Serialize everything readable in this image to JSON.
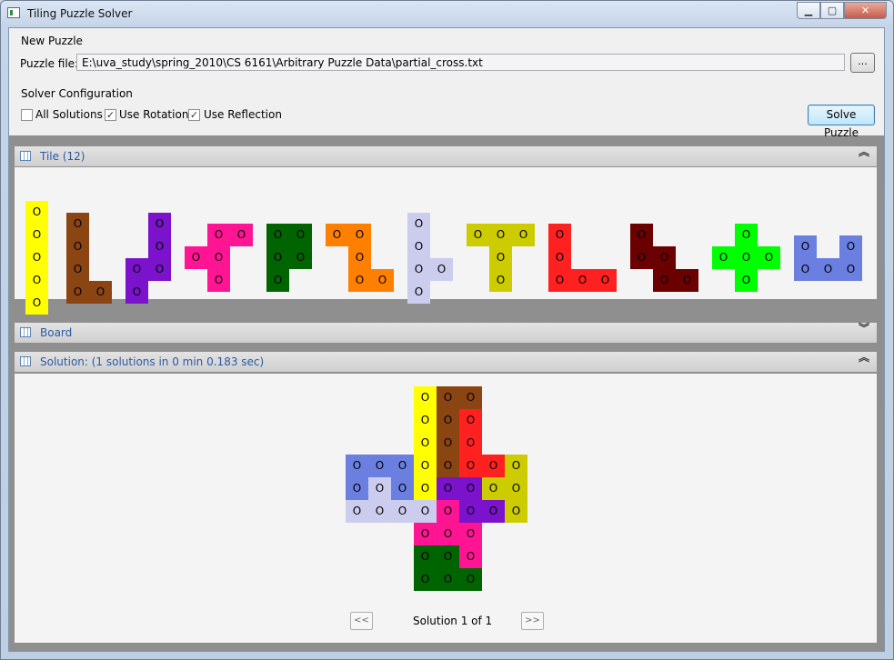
{
  "window": {
    "title": "Tiling Puzzle Solver",
    "minimize": "▁",
    "maximize": "▢",
    "close": "✕"
  },
  "new_puzzle": {
    "group_title": "New Puzzle",
    "file_label": "Puzzle file:",
    "file_value": "E:\\uva_study\\spring_2010\\CS 6161\\Arbitrary Puzzle Data\\partial_cross.txt",
    "browse_label": "..."
  },
  "solver_config": {
    "group_title": "Solver Configuration",
    "options": [
      {
        "label": "All Solutions",
        "checked": false
      },
      {
        "label": "Use Rotation",
        "checked": true
      },
      {
        "label": "Use Reflection",
        "checked": true
      }
    ],
    "solve_label": "Solve Puzzle"
  },
  "panels": {
    "tile": {
      "title": "Tile (12)",
      "state": "expanded"
    },
    "board": {
      "title": "Board",
      "state": "collapsed"
    },
    "solution": {
      "title": "Solution: (1 solutions in 0 min 0.183 sec)",
      "state": "expanded"
    }
  },
  "cell_char": "O",
  "check_char": "✓",
  "chev_expanded": "︽",
  "chev_collapsed": "︾",
  "tiles": [
    {
      "color": "#ffff00",
      "cells": [
        [
          0,
          0
        ],
        [
          0,
          1
        ],
        [
          0,
          2
        ],
        [
          0,
          3
        ],
        [
          0,
          4
        ]
      ]
    },
    {
      "color": "#8b4513",
      "cells": [
        [
          0,
          0
        ],
        [
          0,
          1
        ],
        [
          0,
          2
        ],
        [
          0,
          3
        ],
        [
          1,
          3
        ]
      ]
    },
    {
      "color": "#7b12cc",
      "cells": [
        [
          1,
          0
        ],
        [
          1,
          1
        ],
        [
          0,
          2
        ],
        [
          1,
          2
        ],
        [
          0,
          3
        ]
      ]
    },
    {
      "color": "#ff1493",
      "cells": [
        [
          1,
          0
        ],
        [
          2,
          0
        ],
        [
          0,
          1
        ],
        [
          1,
          1
        ],
        [
          1,
          2
        ]
      ]
    },
    {
      "color": "#006400",
      "cells": [
        [
          0,
          0
        ],
        [
          1,
          0
        ],
        [
          0,
          1
        ],
        [
          1,
          1
        ],
        [
          0,
          2
        ]
      ]
    },
    {
      "color": "#ff8000",
      "cells": [
        [
          0,
          0
        ],
        [
          1,
          0
        ],
        [
          1,
          1
        ],
        [
          1,
          2
        ],
        [
          2,
          2
        ]
      ]
    },
    {
      "color": "#ccccee",
      "cells": [
        [
          0,
          0
        ],
        [
          0,
          1
        ],
        [
          0,
          2
        ],
        [
          1,
          2
        ],
        [
          0,
          3
        ]
      ]
    },
    {
      "color": "#cccc00",
      "cells": [
        [
          0,
          0
        ],
        [
          1,
          0
        ],
        [
          2,
          0
        ],
        [
          1,
          1
        ],
        [
          1,
          2
        ]
      ]
    },
    {
      "color": "#ff2020",
      "cells": [
        [
          0,
          0
        ],
        [
          0,
          1
        ],
        [
          0,
          2
        ],
        [
          1,
          2
        ],
        [
          2,
          2
        ]
      ]
    },
    {
      "color": "#6b0000",
      "cells": [
        [
          0,
          0
        ],
        [
          0,
          1
        ],
        [
          1,
          1
        ],
        [
          1,
          2
        ],
        [
          2,
          2
        ]
      ]
    },
    {
      "color": "#00ff00",
      "cells": [
        [
          1,
          0
        ],
        [
          0,
          1
        ],
        [
          1,
          1
        ],
        [
          2,
          1
        ],
        [
          1,
          2
        ]
      ]
    },
    {
      "color": "#6b7fe0",
      "cells": [
        [
          0,
          0
        ],
        [
          2,
          0
        ],
        [
          0,
          1
        ],
        [
          1,
          1
        ],
        [
          2,
          1
        ]
      ]
    }
  ],
  "solution_grid": [
    "...YBB..",
    "...YBR..",
    "...YBR..",
    "UUUYBRRV",
    "UWUYPPVV",
    "WWWWMPPV",
    "...MMM..",
    "...GGM..",
    "...GGG.."
  ],
  "solution_colors": {
    "Y": "#ffff00",
    "B": "#8b4513",
    "R": "#ff2020",
    "V": "#cccc00",
    "U": "#6b7fe0",
    "W": "#ccccee",
    "P": "#7b12cc",
    "M": "#ff1493",
    "G": "#006400"
  },
  "navigation": {
    "prev": "<<",
    "next": ">>",
    "status": "Solution 1 of 1"
  }
}
